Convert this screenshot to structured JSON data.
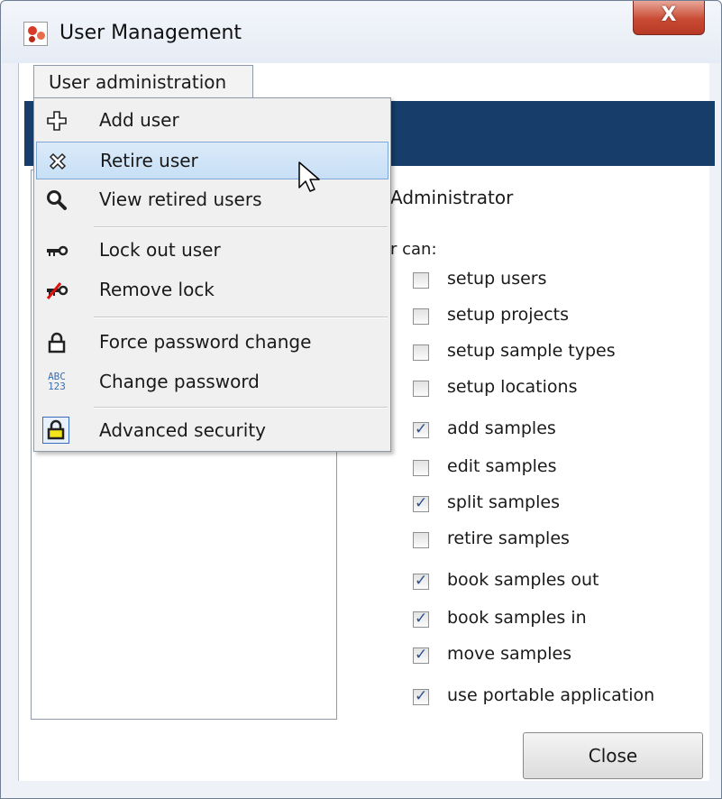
{
  "window": {
    "title": "User Management",
    "close_glyph": "X"
  },
  "menu": {
    "tab_label": "User administration",
    "items": [
      {
        "label": "Add user",
        "icon": "plus-icon"
      },
      {
        "label": "Retire user",
        "icon": "cross-icon"
      },
      {
        "label": "View retired users",
        "icon": "magnifier-icon"
      },
      {
        "label": "Lock out user",
        "icon": "key-icon"
      },
      {
        "label": "Remove lock",
        "icon": "key-crossed-icon"
      },
      {
        "label": "Force password change",
        "icon": "padlock-icon"
      },
      {
        "label": "Change password",
        "icon": "abc123-icon"
      },
      {
        "label": "Advanced security",
        "icon": "padlock-yellow-icon"
      }
    ],
    "highlighted_item": "Retire user",
    "abc_glyph_top": "ABC",
    "abc_glyph_bottom": "123"
  },
  "details": {
    "role": "Administrator",
    "can_label": "r can:",
    "permissions": [
      {
        "label": "setup users",
        "checked": false
      },
      {
        "label": "setup projects",
        "checked": false
      },
      {
        "label": "setup sample types",
        "checked": false
      },
      {
        "label": "setup locations",
        "checked": false
      },
      {
        "label": "add samples",
        "checked": true
      },
      {
        "label": "edit samples",
        "checked": false
      },
      {
        "label": "split samples",
        "checked": true
      },
      {
        "label": "retire samples",
        "checked": false
      },
      {
        "label": "book samples out",
        "checked": true
      },
      {
        "label": "book samples in",
        "checked": true
      },
      {
        "label": "move samples",
        "checked": true
      },
      {
        "label": "use portable application",
        "checked": true
      }
    ]
  },
  "footer": {
    "close_label": "Close"
  },
  "colors": {
    "banner": "#173e6a",
    "highlight": "#c7dff6",
    "close_red": "#c94a33"
  }
}
